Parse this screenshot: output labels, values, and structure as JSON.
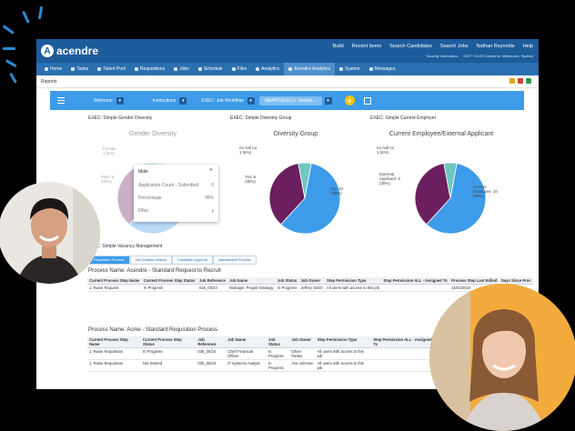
{
  "app": {
    "brand": "acendre",
    "top_menu": [
      "Build",
      "Recent Items",
      "Search Candidates",
      "Search Jobs",
      "Nathan Reynolds",
      "Help"
    ],
    "security_info": "Security Information",
    "timezone": "GMT +10:00 Canberra, Melbourne, Sydney"
  },
  "nav": [
    {
      "label": "Home",
      "active": false
    },
    {
      "label": "Tasks",
      "active": false
    },
    {
      "label": "Talent Pool",
      "active": false
    },
    {
      "label": "Requisitions",
      "active": false
    },
    {
      "label": "Jobs",
      "active": false
    },
    {
      "label": "Schedule",
      "active": false
    },
    {
      "label": "Files",
      "active": false
    },
    {
      "label": "Analytics",
      "active": false
    },
    {
      "label": "Acendre Analytics",
      "active": true
    },
    {
      "label": "System",
      "active": false
    },
    {
      "label": "Messages",
      "active": false
    }
  ],
  "breadcrumb": "Reports",
  "toolbar": {
    "welcome": "Welcome",
    "instructions": "Instructions",
    "workflow": "EXEC: Job Workflow",
    "template": "SMART/EXEC+ Temple...",
    "plus": "+"
  },
  "charts": {
    "gender": {
      "section": "EXEC: Simple Gender Diversity",
      "title": "Gender Diversity",
      "labels": [
        "Female",
        "1 (6%)",
        "Male: 6",
        "(35%)"
      ]
    },
    "group": {
      "section": "EXEC: Simple Diversity Group",
      "title": "Diversity Group",
      "labels_left": [
        "no null no",
        "1 (6%)",
        "Yes: 6",
        "(35%)"
      ],
      "labels_right": [
        "No: 10",
        "(59%)"
      ]
    },
    "employer": {
      "section": "EXEC: Simple Current Employer",
      "title": "Current Employee/External Applicant",
      "labels_left": [
        "no null no",
        "1 (6%)",
        "External",
        "Applicant: 6",
        "(35%)"
      ],
      "labels_right": [
        "Current",
        "Employee: 10",
        "(59%)"
      ]
    }
  },
  "chart_data": [
    {
      "type": "pie",
      "title": "Gender Diversity",
      "categories": [
        "Female",
        "Male",
        "no null"
      ],
      "values": [
        10,
        6,
        1
      ]
    },
    {
      "type": "pie",
      "title": "Diversity Group",
      "categories": [
        "No",
        "Yes",
        "no null"
      ],
      "values": [
        10,
        6,
        1
      ]
    },
    {
      "type": "pie",
      "title": "Current Employee/External Applicant",
      "categories": [
        "Current Employee",
        "External Applicant",
        "no null"
      ],
      "values": [
        10,
        6,
        1
      ]
    }
  ],
  "popup": {
    "title": "Male",
    "close": "×",
    "rows": [
      {
        "label": "Application Count - Submitted",
        "value": "6"
      },
      {
        "label": "Percentage",
        "value": "35%"
      }
    ],
    "filter": "Filter",
    "filter_arrow": "›"
  },
  "vacancy": {
    "section": "EXEC: Simple Vacancy Management",
    "tabs": [
      "Requisition Process",
      "Job Creation Wizard",
      "Candidate Approval",
      "Assessment Process"
    ]
  },
  "process1": {
    "title": "Process Name: Acendre - Standard Request to Recruit",
    "headers": [
      "Current Process Step Name",
      "Current Process Step Status",
      "Job Reference",
      "Job Name",
      "Job Status",
      "Job Owner",
      "Step Permission Type",
      "Step Permission ALL - Assigned To",
      "Process Step Last Edited",
      "Days Since Proc"
    ],
    "rows": [
      [
        "1. Raise Request",
        "In Progress",
        "015_03/24",
        "Manager, People Strategy",
        "In Progress",
        "Jeffrey Smith",
        "All users with access to this job",
        "",
        "15/03/2024",
        ""
      ]
    ]
  },
  "process2": {
    "title": "Process Name: Acme - Standard Requisition Process",
    "headers": [
      "Current Process Step Name",
      "Current Process Step Status",
      "Job Reference",
      "Job Name",
      "Job Status",
      "Job Owner",
      "Step Permission Type",
      "Step Permission ALL - Assigned To",
      "Process Step Last Edited"
    ],
    "rows": [
      [
        "1. Raise Requisition",
        "In Progress",
        "035_05/24",
        "Chief Financial Officer",
        "In Progress",
        "Oliver Parker",
        "All users with access to this job",
        "",
        ""
      ],
      [
        "1. Raise Requisition",
        "Not Started",
        "035_05/24",
        "IT Systems Analyst",
        "In Progress",
        "Ava Johnson",
        "All users with access to this job",
        "",
        ""
      ]
    ]
  },
  "colors": {
    "brand": "#1d5c9b",
    "nav": "#2a6fb0",
    "toolbar": "#3d9be9",
    "pie_blue": "#3d9be9",
    "pie_purple": "#6b1f5e",
    "pie_teal": "#6fc7c0",
    "accent_yellow": "#f5c400"
  }
}
